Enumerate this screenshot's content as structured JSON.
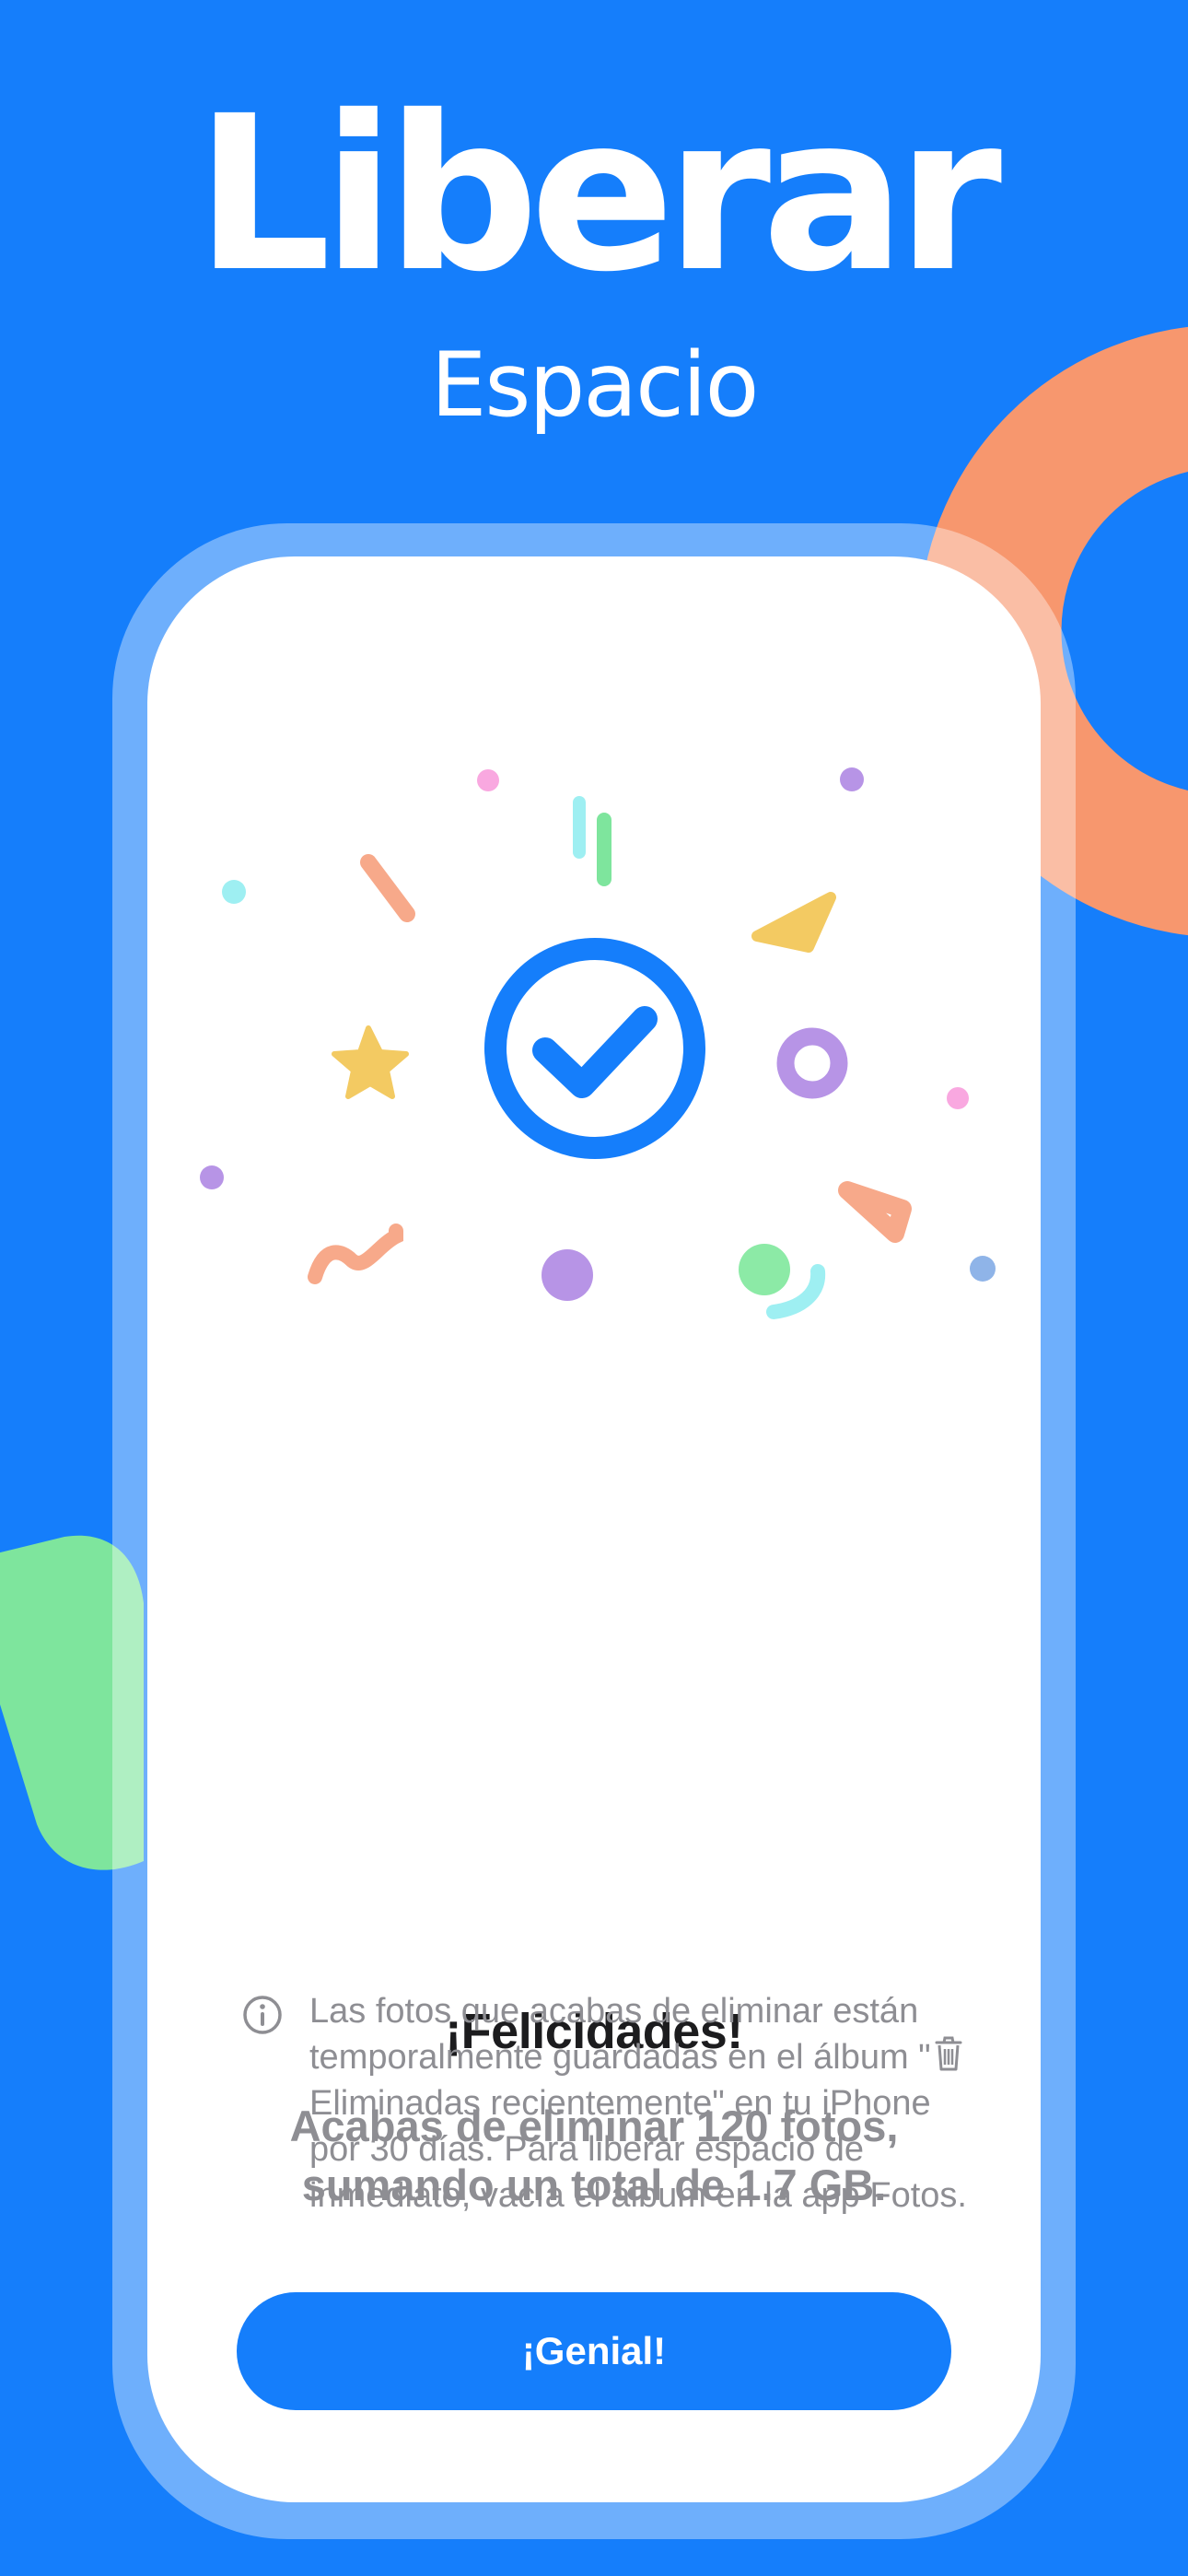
{
  "header": {
    "title": "Liberar",
    "subtitle": "Espacio"
  },
  "screen": {
    "heading": "¡Felicidades!",
    "message": "Acabas de eliminar 120 fotos, sumando un total de 1.7 GB.",
    "info": {
      "text_before": "Las fotos que acabas de eliminar están temporalmente guardadas en el álbum \"",
      "album": "Eliminadas recientemente",
      "text_after": "\" en tu iPhone por 30 días. Para liberar espacio de inmediato, vacía el álbum en la app Fotos."
    },
    "button_label": "¡Genial!"
  },
  "colors": {
    "background": "#157EFB",
    "accent": "#157EFB",
    "decor_orange": "#F7976E",
    "decor_green": "#7EE59D"
  },
  "icons": [
    "check-circle-icon",
    "info-icon",
    "trash-icon"
  ]
}
